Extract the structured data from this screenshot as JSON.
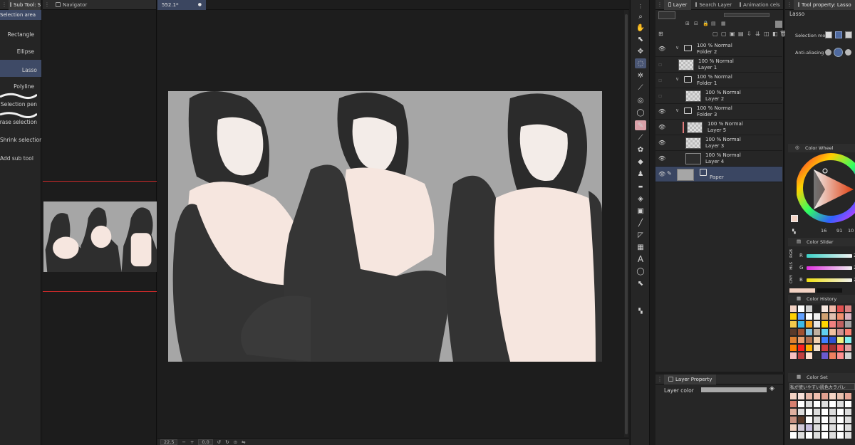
{
  "subtool": {
    "tab_label": "Sub Tool: Selection",
    "header": "Selection area",
    "items": [
      {
        "label": "Rectangle"
      },
      {
        "label": "Ellipse"
      },
      {
        "label": "Lasso"
      },
      {
        "label": "Polyline"
      },
      {
        "label": "Selection pen"
      },
      {
        "label": "Erase selection"
      },
      {
        "label": "Shrink selection"
      },
      {
        "label": "Add sub tool"
      }
    ]
  },
  "navigator": {
    "tab_label": "Navigator"
  },
  "canvas": {
    "tab_label": "552.1*",
    "zoom": "22.5",
    "angle": "0.0"
  },
  "layer_panel": {
    "tabs": [
      "Layer",
      "Search Layer",
      "Animation cels"
    ],
    "layers": [
      {
        "line1": "100 % Normal",
        "line2": "Folder 2",
        "kind": "folder"
      },
      {
        "line1": "100 % Normal",
        "line2": "Layer 1",
        "kind": "raster"
      },
      {
        "line1": "100 % Normal",
        "line2": "Folder 1",
        "kind": "folder"
      },
      {
        "line1": "100 % Normal",
        "line2": "Layer 2",
        "kind": "raster"
      },
      {
        "line1": "100 % Normal",
        "line2": "Folder 3",
        "kind": "folder"
      },
      {
        "line1": "100 % Normal",
        "line2": "Layer 5",
        "kind": "raster"
      },
      {
        "line1": "100 % Normal",
        "line2": "Layer 3",
        "kind": "raster"
      },
      {
        "line1": "100 % Normal",
        "line2": "Layer 4",
        "kind": "image"
      },
      {
        "line1": "",
        "line2": "Paper",
        "kind": "paper"
      }
    ]
  },
  "layer_property": {
    "tab_label": "Layer Property",
    "layer_color_label": "Layer color"
  },
  "tool_property": {
    "tab_label": "Tool property: Lasso",
    "tool_name": "Lasso",
    "selection_mode_label": "Selection mo",
    "anti_aliasing_label": "Anti-aliasing"
  },
  "color_wheel": {
    "tab_label": "Color Wheel",
    "values": [
      "16",
      "91",
      "10"
    ]
  },
  "color_slider": {
    "tab_label": "Color Slider",
    "rows": [
      {
        "label": "R",
        "value": "2"
      },
      {
        "label": "G",
        "value": "2"
      },
      {
        "label": "B",
        "value": "2"
      }
    ],
    "side_labels": [
      "RGB",
      "HLS",
      "CMY"
    ]
  },
  "color_history": {
    "tab_label": "Color History"
  },
  "color_set": {
    "tab_label": "Color Set",
    "set_name": "私が使いやすい肌色カラパレ"
  },
  "colors": {
    "accent_selected": "#3e4a66",
    "main_color": "#f3d2c3",
    "nav_frame": "#d12a2a"
  }
}
